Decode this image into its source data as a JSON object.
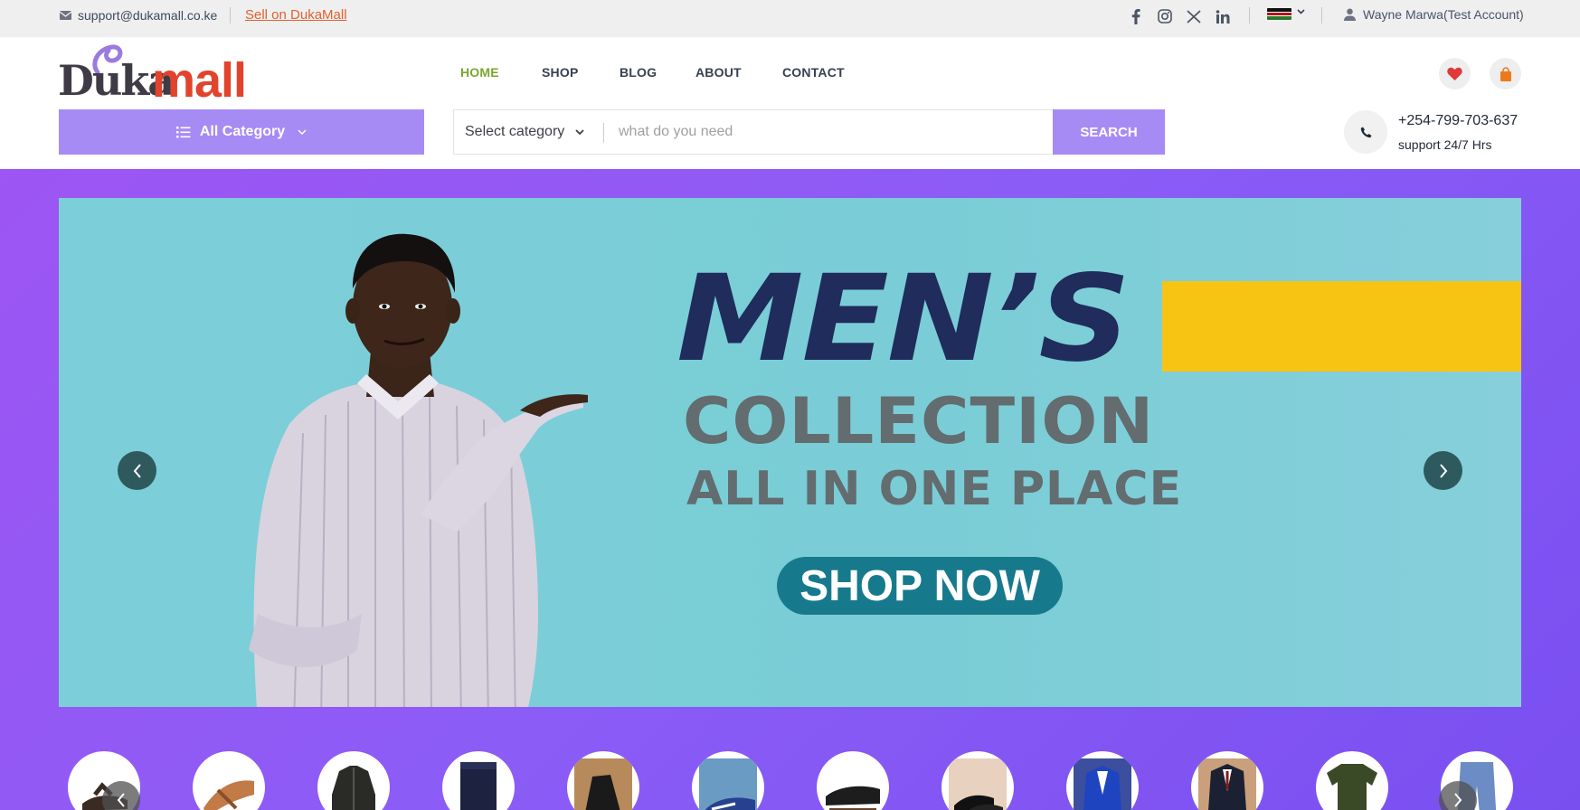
{
  "topbar": {
    "email": "support@dukamall.co.ke",
    "sell_link": "Sell on DukaMall",
    "user": "Wayne Marwa(Test Account)",
    "social": [
      "facebook-icon",
      "instagram-icon",
      "x-icon",
      "linkedin-icon"
    ]
  },
  "header": {
    "logo_duka": "Duka",
    "logo_mall": "mall",
    "nav": [
      "HOME",
      "SHOP",
      "BLOG",
      "ABOUT",
      "CONTACT"
    ],
    "active_nav": "HOME",
    "wishlist_icon": "heart-icon",
    "cart_icon": "bag-icon"
  },
  "search": {
    "all_category": "All Category",
    "select_category": "Select category",
    "placeholder": "what do you need",
    "button": "SEARCH"
  },
  "contact": {
    "phone": "+254-799-703-637",
    "support": "support 24/7 Hrs"
  },
  "banner": {
    "headline": "MEN’S",
    "line2": "COLLECTION",
    "line3": "ALL IN ONE PLACE",
    "cta": "SHOP NOW"
  },
  "categories": [
    "sandal",
    "sandal",
    "jacket",
    "jeans",
    "sneaker",
    "sneaker",
    "loafer",
    "shoes",
    "suit",
    "suit",
    "t-shirt",
    "jeans"
  ],
  "colors": {
    "accent": "#a78bf4",
    "hero_bg": "#8b5cf6",
    "banner_bg": "#7ccfd8",
    "nav_active": "#7aa52c",
    "brand_red": "#e2432c"
  }
}
